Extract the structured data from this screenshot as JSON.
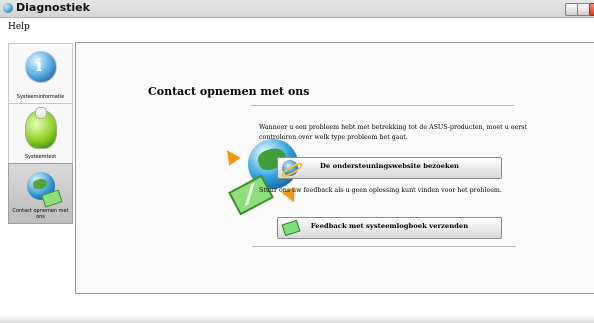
{
  "window": {
    "title": "Diagnostiek"
  },
  "menubar": {
    "items": [
      {
        "label": "Help"
      }
    ]
  },
  "sidebar": {
    "items": [
      {
        "label": "Systeeminformatie",
        "icon": "info-icon"
      },
      {
        "label": "Systeemtest",
        "icon": "flask-icon"
      },
      {
        "label": "Contact opnemen met ons",
        "icon": "globe-envelope-icon",
        "active": true
      }
    ]
  },
  "content": {
    "heading": "Contact opnemen met ons",
    "paragraph1": "Wanneer u een probleem hebt met betrekking tot de ASUS-producten, moet u eerst controleren over welk type probleem het gaat.",
    "button_support": "De ondersteuningswebsite bezoeken",
    "paragraph2": "Stuur ons uw feedback als u geen oplossing kunt vinden voor het probleem.",
    "button_feedback": "Feedback met systeemlogboek verzenden"
  }
}
